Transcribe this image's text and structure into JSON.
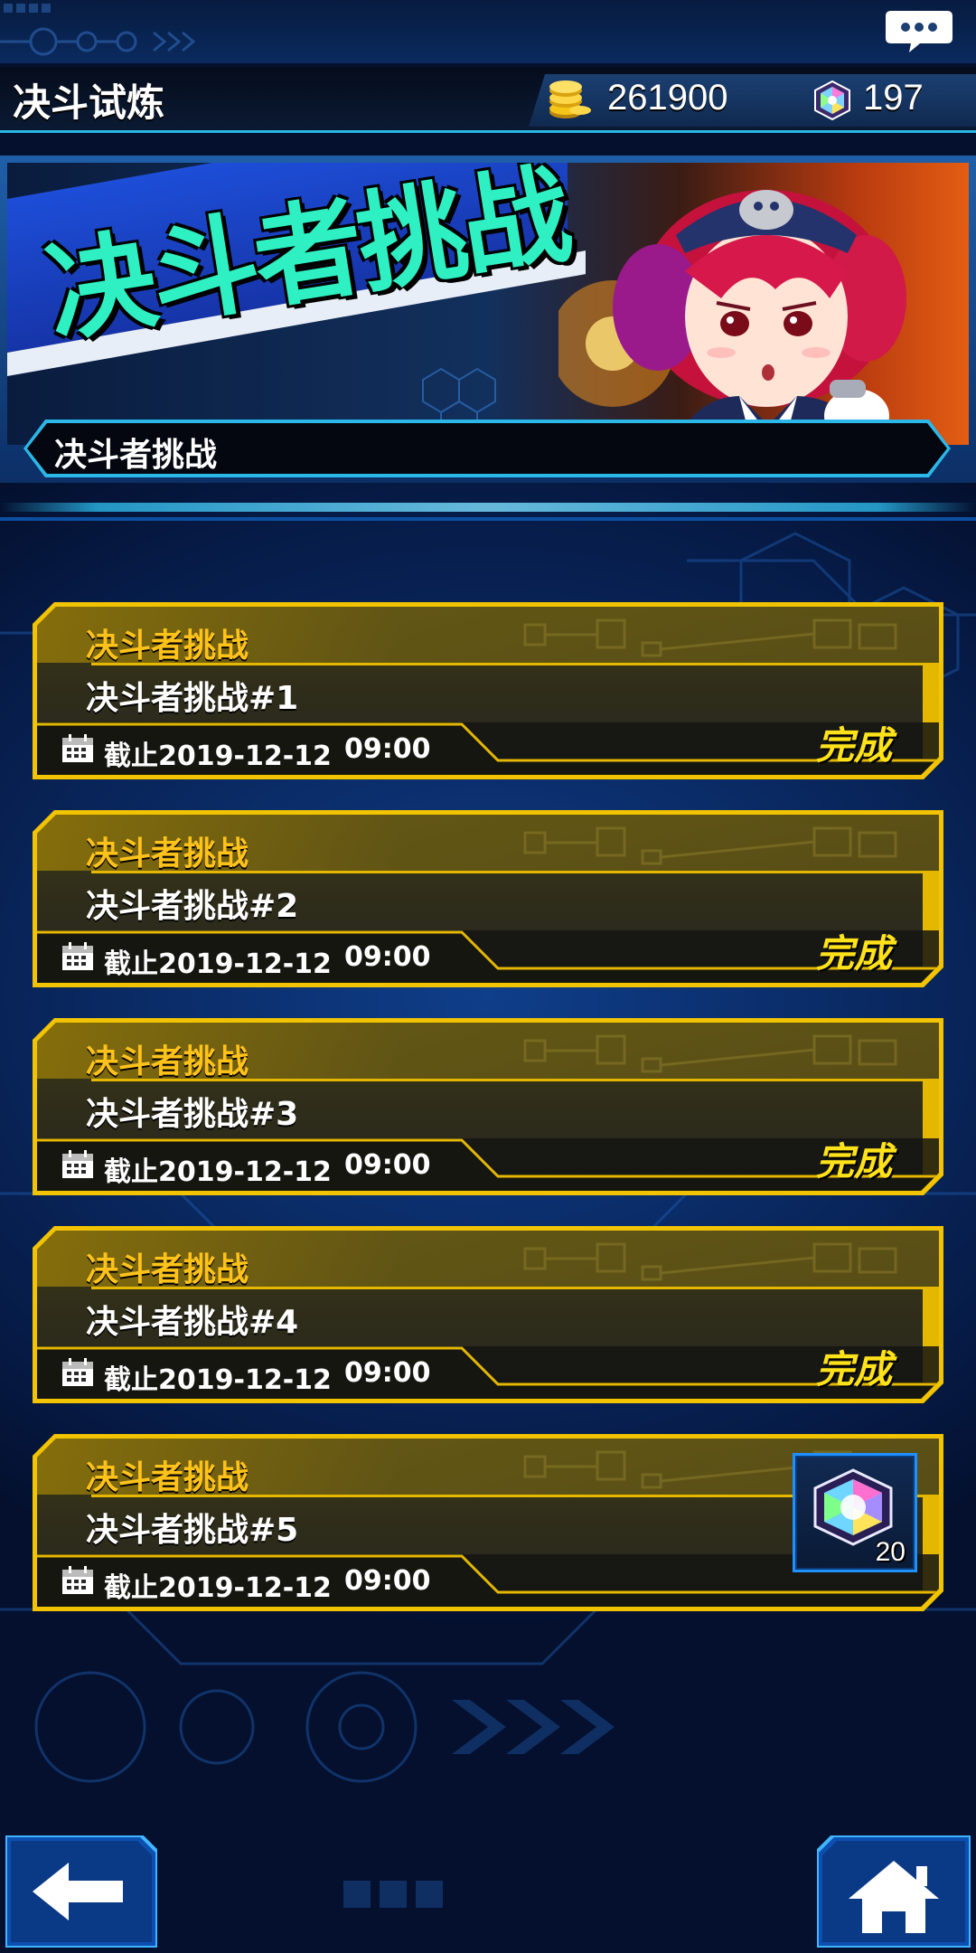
{
  "header": {
    "title": "决斗试炼",
    "coins": "261900",
    "gems": "197",
    "coin_icon": "gold-coin-icon",
    "gem_icon": "rainbow-gem-icon",
    "chat_icon": "chat-bubble-icon"
  },
  "banner": {
    "art_title": "决斗者挑战",
    "caption": "决斗者挑战"
  },
  "challenges": [
    {
      "category": "决斗者挑战",
      "name": "决斗者挑战#1",
      "deadline": "截止2019-12-12",
      "time": "09:00",
      "status": "完成"
    },
    {
      "category": "决斗者挑战",
      "name": "决斗者挑战#2",
      "deadline": "截止2019-12-12",
      "time": "09:00",
      "status": "完成"
    },
    {
      "category": "决斗者挑战",
      "name": "决斗者挑战#3",
      "deadline": "截止2019-12-12",
      "time": "09:00",
      "status": "完成"
    },
    {
      "category": "决斗者挑战",
      "name": "决斗者挑战#4",
      "deadline": "截止2019-12-12",
      "time": "09:00",
      "status": "完成"
    },
    {
      "category": "决斗者挑战",
      "name": "决斗者挑战#5",
      "deadline": "截止2019-12-12",
      "time": "09:00",
      "reward_count": "20",
      "reward_icon": "rainbow-gem-icon"
    }
  ],
  "nav": {
    "back_icon": "back-arrow-icon",
    "home_icon": "home-icon"
  },
  "colors": {
    "card_border": "#f2c400",
    "category_text": "#ffc21a",
    "status_text": "#ffe21a",
    "accent_cyan": "#2bb7e8",
    "banner_title": "#2ff0c2"
  }
}
